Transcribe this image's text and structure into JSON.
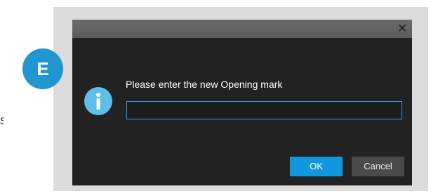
{
  "badge": {
    "letter": "E",
    "color": "#2196d0"
  },
  "edge_text": "s",
  "dialog": {
    "close_label": "×",
    "icon": "info-icon",
    "prompt": "Please enter the new Opening mark",
    "input": {
      "value": "",
      "placeholder": ""
    },
    "buttons": {
      "ok": "OK",
      "cancel": "Cancel"
    },
    "colors": {
      "background": "#222222",
      "titlebar": "#5f5f5f",
      "accent": "#1197de",
      "icon": "#5cc0ea",
      "frame": "#dcdcdc"
    }
  }
}
